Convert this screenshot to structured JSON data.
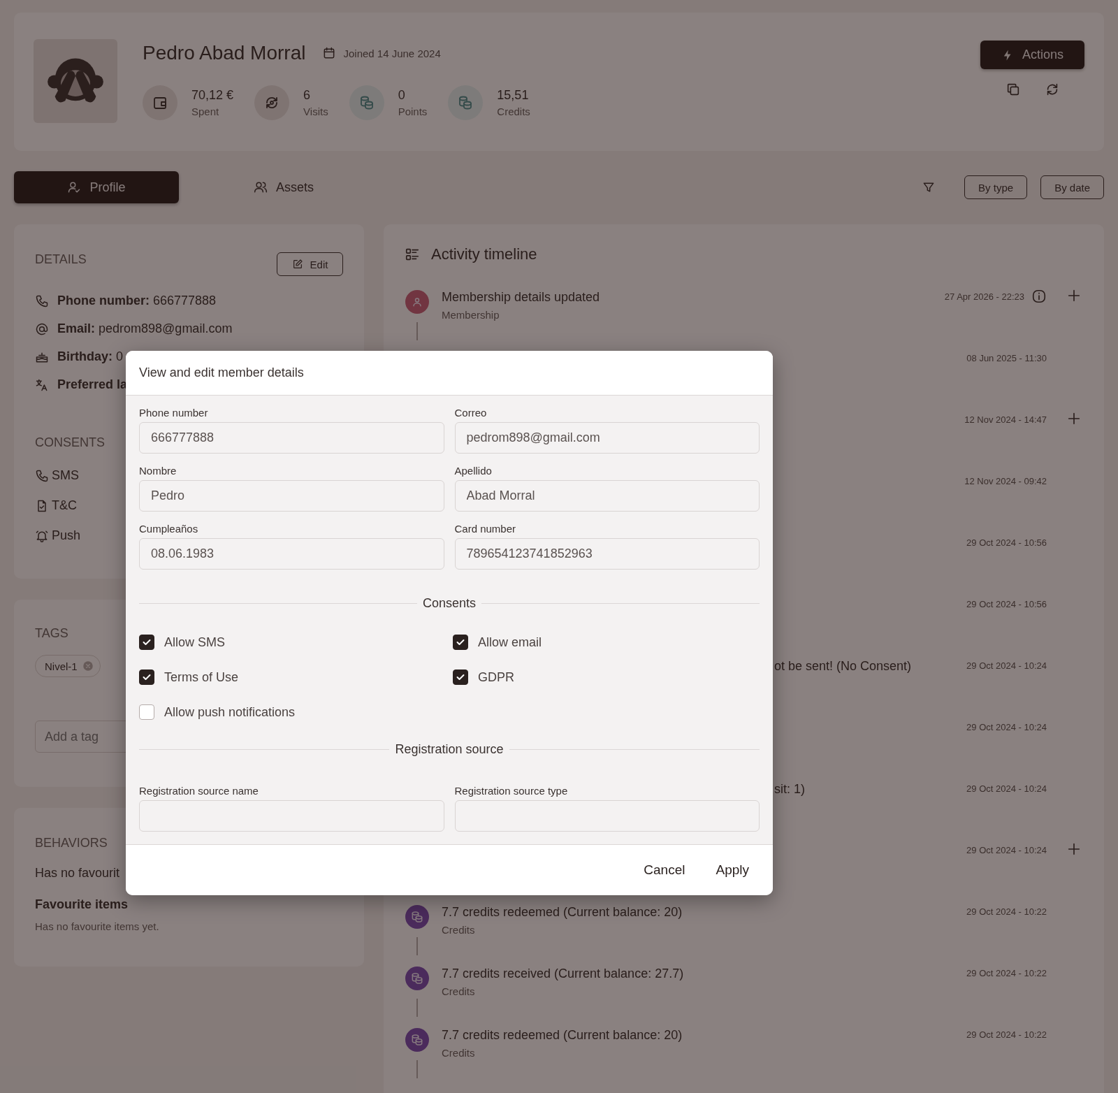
{
  "header": {
    "name": "Pedro Abad Morral",
    "joined": "Joined 14 June 2024",
    "actions_label": "Actions",
    "stats": [
      {
        "kind": "wallet",
        "value": "70,12 €",
        "label": "Spent"
      },
      {
        "kind": "visits",
        "value": "6",
        "label": "Visits"
      },
      {
        "kind": "coins",
        "value": "0",
        "label": "Points"
      },
      {
        "kind": "coins",
        "value": "15,51",
        "label": "Credits"
      }
    ]
  },
  "tabs": [
    {
      "label": "Profile",
      "kind": "profile",
      "selected": true
    },
    {
      "label": "Assets",
      "kind": "assets",
      "selected": false
    }
  ],
  "filters": [
    "By type",
    "By date"
  ],
  "details": {
    "heading": "DETAILS",
    "edit_label": "Edit",
    "rows": [
      {
        "kind": "phone",
        "label": "Phone number:",
        "value": "666777888"
      },
      {
        "kind": "email",
        "label": "Email:",
        "value": "pedrom898@gmail.com"
      },
      {
        "kind": "birthday",
        "label": "Birthday:",
        "value": "0"
      },
      {
        "kind": "language",
        "label": "Preferred la"
      }
    ]
  },
  "consents": {
    "heading": "CONSENTS",
    "items": [
      {
        "kind": "phone",
        "label": "SMS"
      },
      {
        "kind": "document",
        "label": "T&C"
      },
      {
        "kind": "bell",
        "label": "Push"
      }
    ]
  },
  "tags": {
    "heading": "TAGS",
    "items": [
      "Nivel-1"
    ],
    "placeholder": "Add a tag"
  },
  "behaviors": {
    "heading": "BEHAVIORS",
    "text": "Has no favourit",
    "subheading": "Favourite items",
    "subtext": "Has no favourite items yet."
  },
  "timeline": {
    "title": "Activity timeline",
    "items": [
      {
        "kind": "membership",
        "title": "Membership details updated",
        "subtitle": "Membership",
        "date": "27 Apr 2026 - 22:23",
        "info": true,
        "expandable": true
      },
      {
        "kind": "covered",
        "date": "08 Jun 2025 - 11:30",
        "expandable": false
      },
      {
        "kind": "covered",
        "date": "12 Nov 2024 - 14:47",
        "expandable": true
      },
      {
        "kind": "covered",
        "date": "12 Nov 2024 - 09:42",
        "expandable": false
      },
      {
        "kind": "covered",
        "date": "29 Oct 2024 - 10:56",
        "expandable": false
      },
      {
        "kind": "covered",
        "date": "29 Oct 2024 - 10:56",
        "expandable": false
      },
      {
        "kind": "partial",
        "title": "ot be sent! (No Consent)",
        "date": "29 Oct 2024 - 10:24",
        "expandable": false
      },
      {
        "kind": "covered",
        "date": "29 Oct 2024 - 10:24",
        "expandable": false
      },
      {
        "kind": "partial",
        "title": "sit: 1)",
        "date": "29 Oct 2024 - 10:24",
        "expandable": false
      },
      {
        "kind": "covered",
        "date": "29 Oct 2024 - 10:24",
        "expandable": true
      },
      {
        "kind": "credits",
        "title": "7.7 credits redeemed (Current balance: 20)",
        "subtitle": "Credits",
        "date": "29 Oct 2024 - 10:22",
        "expandable": false
      },
      {
        "kind": "credits",
        "title": "7.7 credits received (Current balance: 27.7)",
        "subtitle": "Credits",
        "date": "29 Oct 2024 - 10:22",
        "expandable": false
      },
      {
        "kind": "credits",
        "title": "7.7 credits redeemed (Current balance: 20)",
        "subtitle": "Credits",
        "date": "29 Oct 2024 - 10:22",
        "expandable": false
      }
    ]
  },
  "modal": {
    "title": "View and edit member details",
    "fields": [
      {
        "label": "Phone number",
        "value": "666777888"
      },
      {
        "label": "Correo",
        "value": "pedrom898@gmail.com"
      },
      {
        "label": "Nombre",
        "value": "Pedro"
      },
      {
        "label": "Apellido",
        "value": "Abad Morral"
      },
      {
        "label": "Cumpleaños",
        "value": "08.06.1983"
      },
      {
        "label": "Card number",
        "value": "789654123741852963"
      }
    ],
    "consents_heading": "Consents",
    "consents": [
      {
        "label": "Allow SMS",
        "checked": true
      },
      {
        "label": "Allow email",
        "checked": true
      },
      {
        "label": "Terms of Use",
        "checked": true
      },
      {
        "label": "GDPR",
        "checked": true
      },
      {
        "label": "Allow push notifications",
        "checked": false
      }
    ],
    "source_heading": "Registration source",
    "source_fields": [
      {
        "label": "Registration source name"
      },
      {
        "label": "Registration source type"
      }
    ],
    "buttons": [
      "Cancel",
      "Apply"
    ]
  }
}
